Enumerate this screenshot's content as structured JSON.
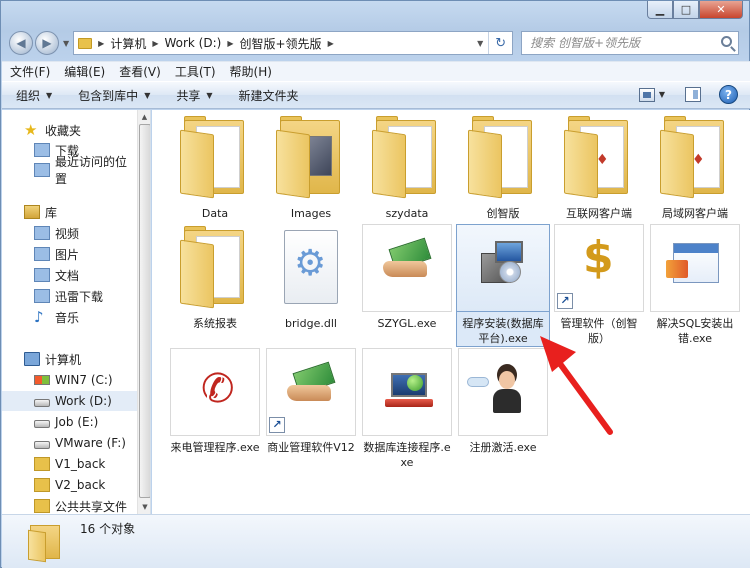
{
  "window": {
    "caption_buttons": [
      "minimize",
      "maximize",
      "close"
    ]
  },
  "address_bar": {
    "crumbs": [
      "计算机",
      "Work (D:)",
      "创智版+领先版"
    ],
    "search_placeholder": "搜索 创智版+领先版"
  },
  "menu": [
    "文件(F)",
    "编辑(E)",
    "查看(V)",
    "工具(T)",
    "帮助(H)"
  ],
  "toolbar": {
    "organize": "组织",
    "include_library": "包含到库中",
    "share": "共享",
    "new_folder": "新建文件夹"
  },
  "nav": {
    "favorites": "收藏夹",
    "downloads": "下载",
    "recent": "最近访问的位置",
    "libraries": "库",
    "videos": "视频",
    "pictures": "图片",
    "documents": "文档",
    "thunder": "迅雷下载",
    "music": "音乐",
    "computer": "计算机",
    "drive_c": "WIN7 (C:)",
    "drive_d": "Work (D:)",
    "drive_e": "Job (E:)",
    "drive_f": "VMware (F:)",
    "v1": "V1_back",
    "v2": "V2_back",
    "shared": "公共共享文件"
  },
  "files": {
    "f1": "Data",
    "f2": "Images",
    "f3": "szydata",
    "f4": "创智版",
    "f5": "互联网客户端",
    "f6": "局域网客户端",
    "f7": "系统报表",
    "f8": "bridge.dll",
    "f9": "SZYGL.exe",
    "f10": "程序安装(数据库平台).exe",
    "f11": "管理软件（创智版）",
    "f12": "解决SQL安装出错.exe",
    "f13": "来电管理程序.exe",
    "f14": "商业管理软件V12",
    "f15": "数据库连接程序.exe",
    "f16": "注册激活.exe"
  },
  "status": {
    "count": "16 个对象"
  },
  "colors": {
    "annotation_arrow": "#e8201e",
    "selection": "#dce9f8"
  }
}
